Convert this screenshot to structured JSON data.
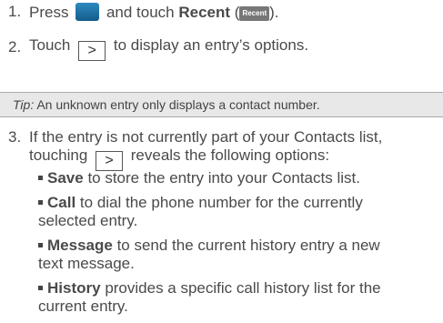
{
  "step1": {
    "number": "1.",
    "prefix": "Press",
    "phone_icon": "phone-icon",
    "middle": "and touch",
    "recent_bold": "Recent",
    "paren_open": "(",
    "recent_icon_label": "Recent",
    "suffix": ")."
  },
  "step2": {
    "number": "2.",
    "prefix": "Touch",
    "suffix": "to display an entry’s options."
  },
  "tip": {
    "label": "Tip:",
    "text": "An unknown entry only displays a contact number."
  },
  "step3": {
    "number": "3.",
    "line1": "If the entry is not currently part of your Contacts list,",
    "line2_prefix": "touching",
    "line2_suffix": "reveals the following options:"
  },
  "chevron_glyph": ">",
  "options": [
    {
      "title": "Save",
      "line1": "to store the entry into your Contacts list.",
      "line2": ""
    },
    {
      "title": "Call",
      "line1": "to dial the phone number for the currently",
      "line2": "selected entry."
    },
    {
      "title": "Message",
      "line1": "to send the current history entry a new",
      "line2": "text message."
    },
    {
      "title": "History",
      "line1": "provides a specific call history list for the",
      "line2": "current entry."
    }
  ]
}
